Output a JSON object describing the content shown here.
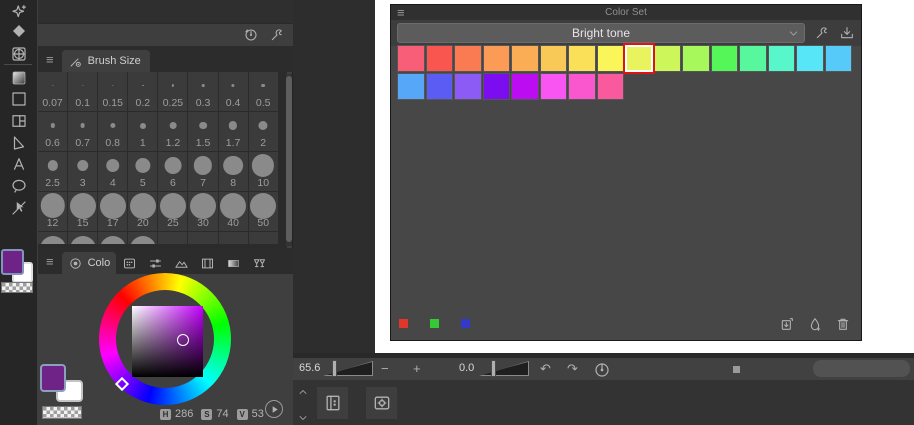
{
  "left_toolbar": {
    "tools": [
      {
        "name": "decoration-tool",
        "icon": "decoration-icon"
      },
      {
        "name": "eraser-tool",
        "icon": "eraser-icon"
      },
      {
        "name": "blend-tool",
        "icon": "blend-icon"
      },
      {
        "name": "gradient-tool",
        "icon": "gradient-icon"
      },
      {
        "name": "figure-tool",
        "icon": "rectangle-icon"
      },
      {
        "name": "frame-border-tool",
        "icon": "frame-icon"
      },
      {
        "name": "ruler-tool",
        "icon": "ruler-icon"
      },
      {
        "name": "text-tool",
        "icon": "text-icon"
      },
      {
        "name": "balloon-tool",
        "icon": "balloon-icon"
      },
      {
        "name": "operation-tool",
        "icon": "object-icon"
      }
    ],
    "foreground_color": "#702387",
    "background_color": "#ffffff"
  },
  "tool_property_footer": {
    "icons": [
      "history-icon",
      "wrench-icon"
    ],
    "menu_glyph": "≡"
  },
  "brush_size_panel": {
    "menu_glyph": "≡",
    "tab_label": "Brush Size",
    "tab_icon": "brush-icon",
    "sizes": [
      "0.07",
      "0.1",
      "0.15",
      "0.2",
      "0.25",
      "0.3",
      "0.4",
      "0.5",
      "0.6",
      "0.7",
      "0.8",
      "1",
      "1.2",
      "1.5",
      "1.7",
      "2",
      "2.5",
      "3",
      "4",
      "5",
      "6",
      "7",
      "8",
      "10",
      "12",
      "15",
      "17",
      "20",
      "25",
      "30",
      "40",
      "50"
    ]
  },
  "color_wheel_panel": {
    "menu_glyph": "≡",
    "active_tab_label": "Colo",
    "active_tab_icon": "colorwheel-icon",
    "other_tabs": [
      {
        "name": "tab-color-set",
        "icon": "colorset-icon"
      },
      {
        "name": "tab-color-slider",
        "icon": "sliders-icon"
      },
      {
        "name": "tab-approximate-color",
        "icon": "approx-icon"
      },
      {
        "name": "tab-color-history",
        "icon": "filmstrip-icon"
      },
      {
        "name": "tab-gradient",
        "icon": "gradient-tab-icon"
      },
      {
        "name": "tab-intermediate-color",
        "icon": "mix-icon"
      }
    ],
    "hue_color": "#c400ff",
    "hsv": {
      "h_label": "H",
      "h": "286",
      "s_label": "S",
      "s": "74",
      "v_label": "V",
      "v": "53"
    },
    "foreground_color": "#702387",
    "background_color": "#ffffff"
  },
  "color_set_window": {
    "title": "Color Set",
    "menu_glyph": "≡",
    "selected_set": "Bright tone",
    "toolbar_icons": [
      "wrench-icon",
      "import-icon"
    ],
    "row1": [
      "#f85e78",
      "#f9564f",
      "#fa7a52",
      "#fb9b55",
      "#fbad56",
      "#f8c957",
      "#f9e058",
      "#faf559",
      "#e9f35e",
      "#cdf65b",
      "#a7f85a",
      "#55f657",
      "#57f79d",
      "#58f6cb",
      "#57e5f8",
      "#56cbf9"
    ],
    "row2": [
      "#57a7f9",
      "#5a5cf3",
      "#8c5bf6",
      "#7c0df0",
      "#bc0df2",
      "#f955f3",
      "#fa57ce",
      "#f95a9d"
    ],
    "selected_row": 1,
    "selected_index": 8,
    "selection_border_color": "#dc1414",
    "footer_swatches": [
      "#e2362b",
      "#35c935",
      "#3339c8"
    ],
    "footer_icons": [
      "export-icon",
      "droplet-add-icon",
      "trash-icon"
    ]
  },
  "navigation_bar": {
    "zoom_value": "65.6",
    "minus_label": "−",
    "plus_label": "+",
    "rotate_value": "0.0",
    "undo_glyph": "↶",
    "redo_glyph": "↷"
  }
}
